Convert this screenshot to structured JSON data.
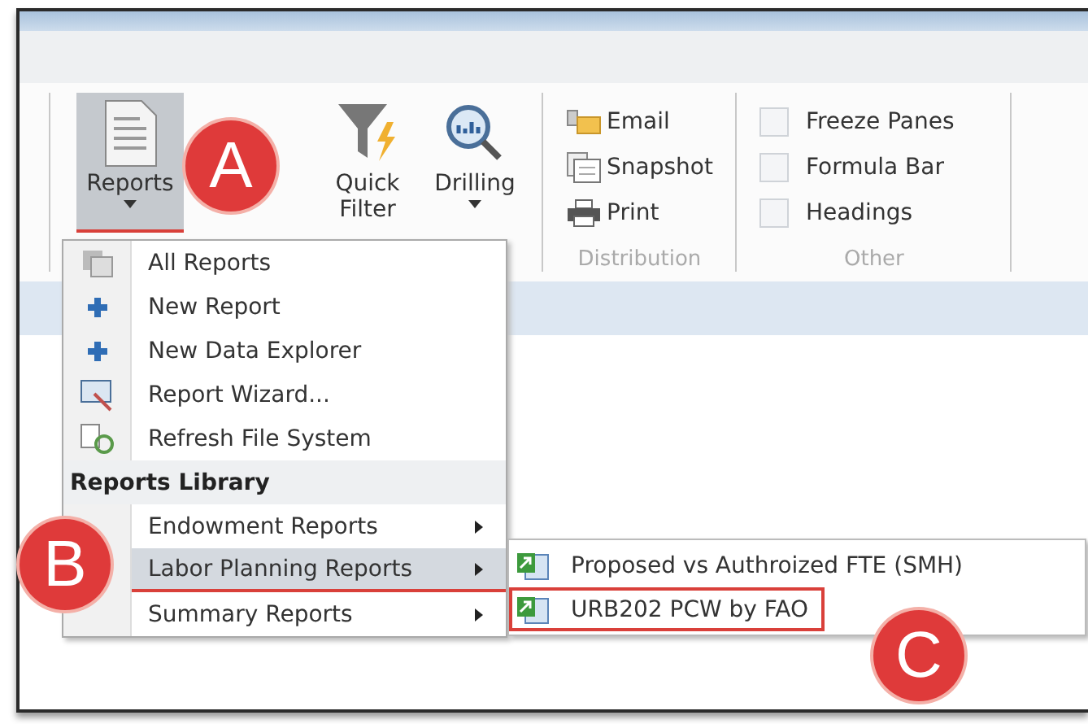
{
  "ribbon": {
    "large_buttons": [
      {
        "label": "Reports",
        "selected": true,
        "dropdown": true
      },
      {
        "label": "Quick Filter",
        "selected": false,
        "dropdown": false
      },
      {
        "label": "Drilling",
        "selected": false,
        "dropdown": true
      }
    ],
    "distribution": {
      "label": "Distribution",
      "buttons": [
        "Email",
        "Snapshot",
        "Print"
      ]
    },
    "other": {
      "label": "Other",
      "checkboxes": [
        {
          "label": "Freeze Panes",
          "checked": false
        },
        {
          "label": "Formula Bar",
          "checked": false
        },
        {
          "label": "Headings",
          "checked": false
        }
      ]
    }
  },
  "reports_menu": {
    "items": [
      {
        "kind": "command",
        "label": "All Reports",
        "selected": false
      },
      {
        "kind": "command",
        "label": "New Report",
        "selected": false
      },
      {
        "kind": "command",
        "label": "New Data Explorer",
        "selected": false
      },
      {
        "kind": "command",
        "label": "Report Wizard...",
        "selected": false
      },
      {
        "kind": "command",
        "label": "Refresh File System",
        "selected": false
      },
      {
        "kind": "header",
        "label": "Reports Library"
      },
      {
        "kind": "submenu",
        "label": "Endowment Reports",
        "selected": false
      },
      {
        "kind": "submenu",
        "label": "Labor Planning Reports",
        "selected": true
      },
      {
        "kind": "submenu",
        "label": "Summary Reports",
        "selected": false
      }
    ]
  },
  "submenu": {
    "items": [
      {
        "label": "Proposed vs Authroized FTE (SMH)",
        "outlined": false
      },
      {
        "label": "URB202 PCW by FAO",
        "outlined": true
      }
    ]
  },
  "callouts": [
    {
      "label": "A"
    },
    {
      "label": "B"
    },
    {
      "label": "C"
    }
  ]
}
